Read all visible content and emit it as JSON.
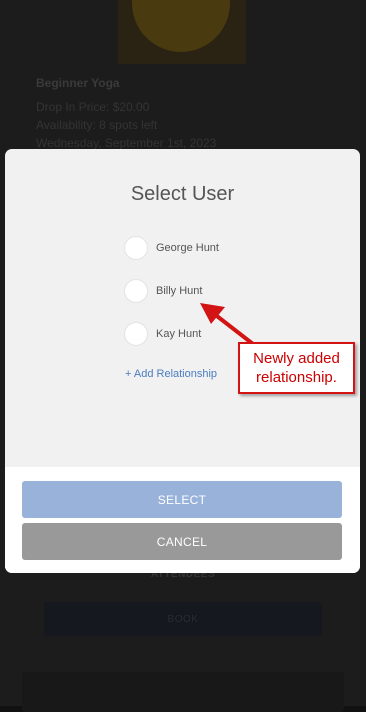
{
  "background": {
    "class_title": "Beginner Yoga",
    "lines": [
      "Drop In Price: $20.00",
      "Availability: 8 spots left",
      "Wednesday, September 1st, 2023"
    ],
    "attendees_label": "ATTENDEES",
    "book_button_label": "BOOK"
  },
  "modal": {
    "title": "Select User",
    "users": [
      {
        "name": "George Hunt",
        "selected": false
      },
      {
        "name": "Billy Hunt",
        "selected": false
      },
      {
        "name": "Kay Hunt",
        "selected": false
      }
    ],
    "add_relationship_label": "+ Add Relationship",
    "select_button_label": "SELECT",
    "cancel_button_label": "CANCEL"
  },
  "annotation": {
    "text": "Newly added\nrelationship."
  },
  "colors": {
    "accent_link": "#4a7cc0",
    "select_button": "#98b2da",
    "cancel_button": "#999999",
    "annotation_red": "#d21414"
  },
  "icons": {
    "radio": "radio-unchecked-icon",
    "arrow": "callout-arrow-icon"
  }
}
